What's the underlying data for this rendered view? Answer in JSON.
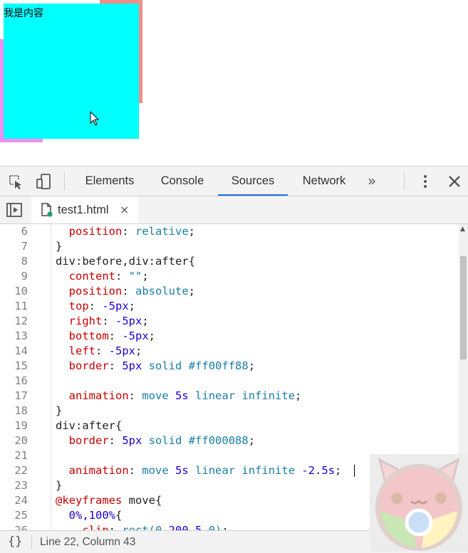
{
  "preview": {
    "box_text": "我是内容",
    "colors": {
      "box": "#00ffff",
      "pink_border": "#f18ff0",
      "red_border": "#f58d88"
    }
  },
  "devtools": {
    "tabs": [
      {
        "label": "Elements"
      },
      {
        "label": "Console"
      },
      {
        "label": "Sources",
        "active": true
      },
      {
        "label": "Network"
      }
    ],
    "more_tabs": "»",
    "file_tab": {
      "label": "test1.html",
      "close": "×"
    },
    "accent_color": "#1a73e8",
    "code_lines": [
      {
        "num": "6",
        "text": "  position: relative;"
      },
      {
        "num": "7",
        "text": "}"
      },
      {
        "num": "8",
        "text": "div:before,div:after{"
      },
      {
        "num": "9",
        "text": "  content: \"\";"
      },
      {
        "num": "10",
        "text": "  position: absolute;"
      },
      {
        "num": "11",
        "text": "  top: -5px;"
      },
      {
        "num": "12",
        "text": "  right: -5px;"
      },
      {
        "num": "13",
        "text": "  bottom: -5px;"
      },
      {
        "num": "14",
        "text": "  left: -5px;"
      },
      {
        "num": "15",
        "text": "  border: 5px solid #ff00ff88;"
      },
      {
        "num": "16",
        "text": ""
      },
      {
        "num": "17",
        "text": "  animation: move 5s linear infinite;"
      },
      {
        "num": "18",
        "text": "}"
      },
      {
        "num": "19",
        "text": "div:after{"
      },
      {
        "num": "20",
        "text": "  border: 5px solid #ff000088;"
      },
      {
        "num": "21",
        "text": ""
      },
      {
        "num": "22",
        "text": "  animation: move 5s linear infinite -2.5s;"
      },
      {
        "num": "23",
        "text": "}"
      },
      {
        "num": "24",
        "text": "@keyframes move{"
      },
      {
        "num": "25",
        "text": "  0%,100%{"
      },
      {
        "num": "26",
        "text": "    clip: rect(0 200 5 0);"
      }
    ],
    "status": {
      "brace_icon": "{}",
      "position_text": "Line 22, Column 43"
    }
  }
}
